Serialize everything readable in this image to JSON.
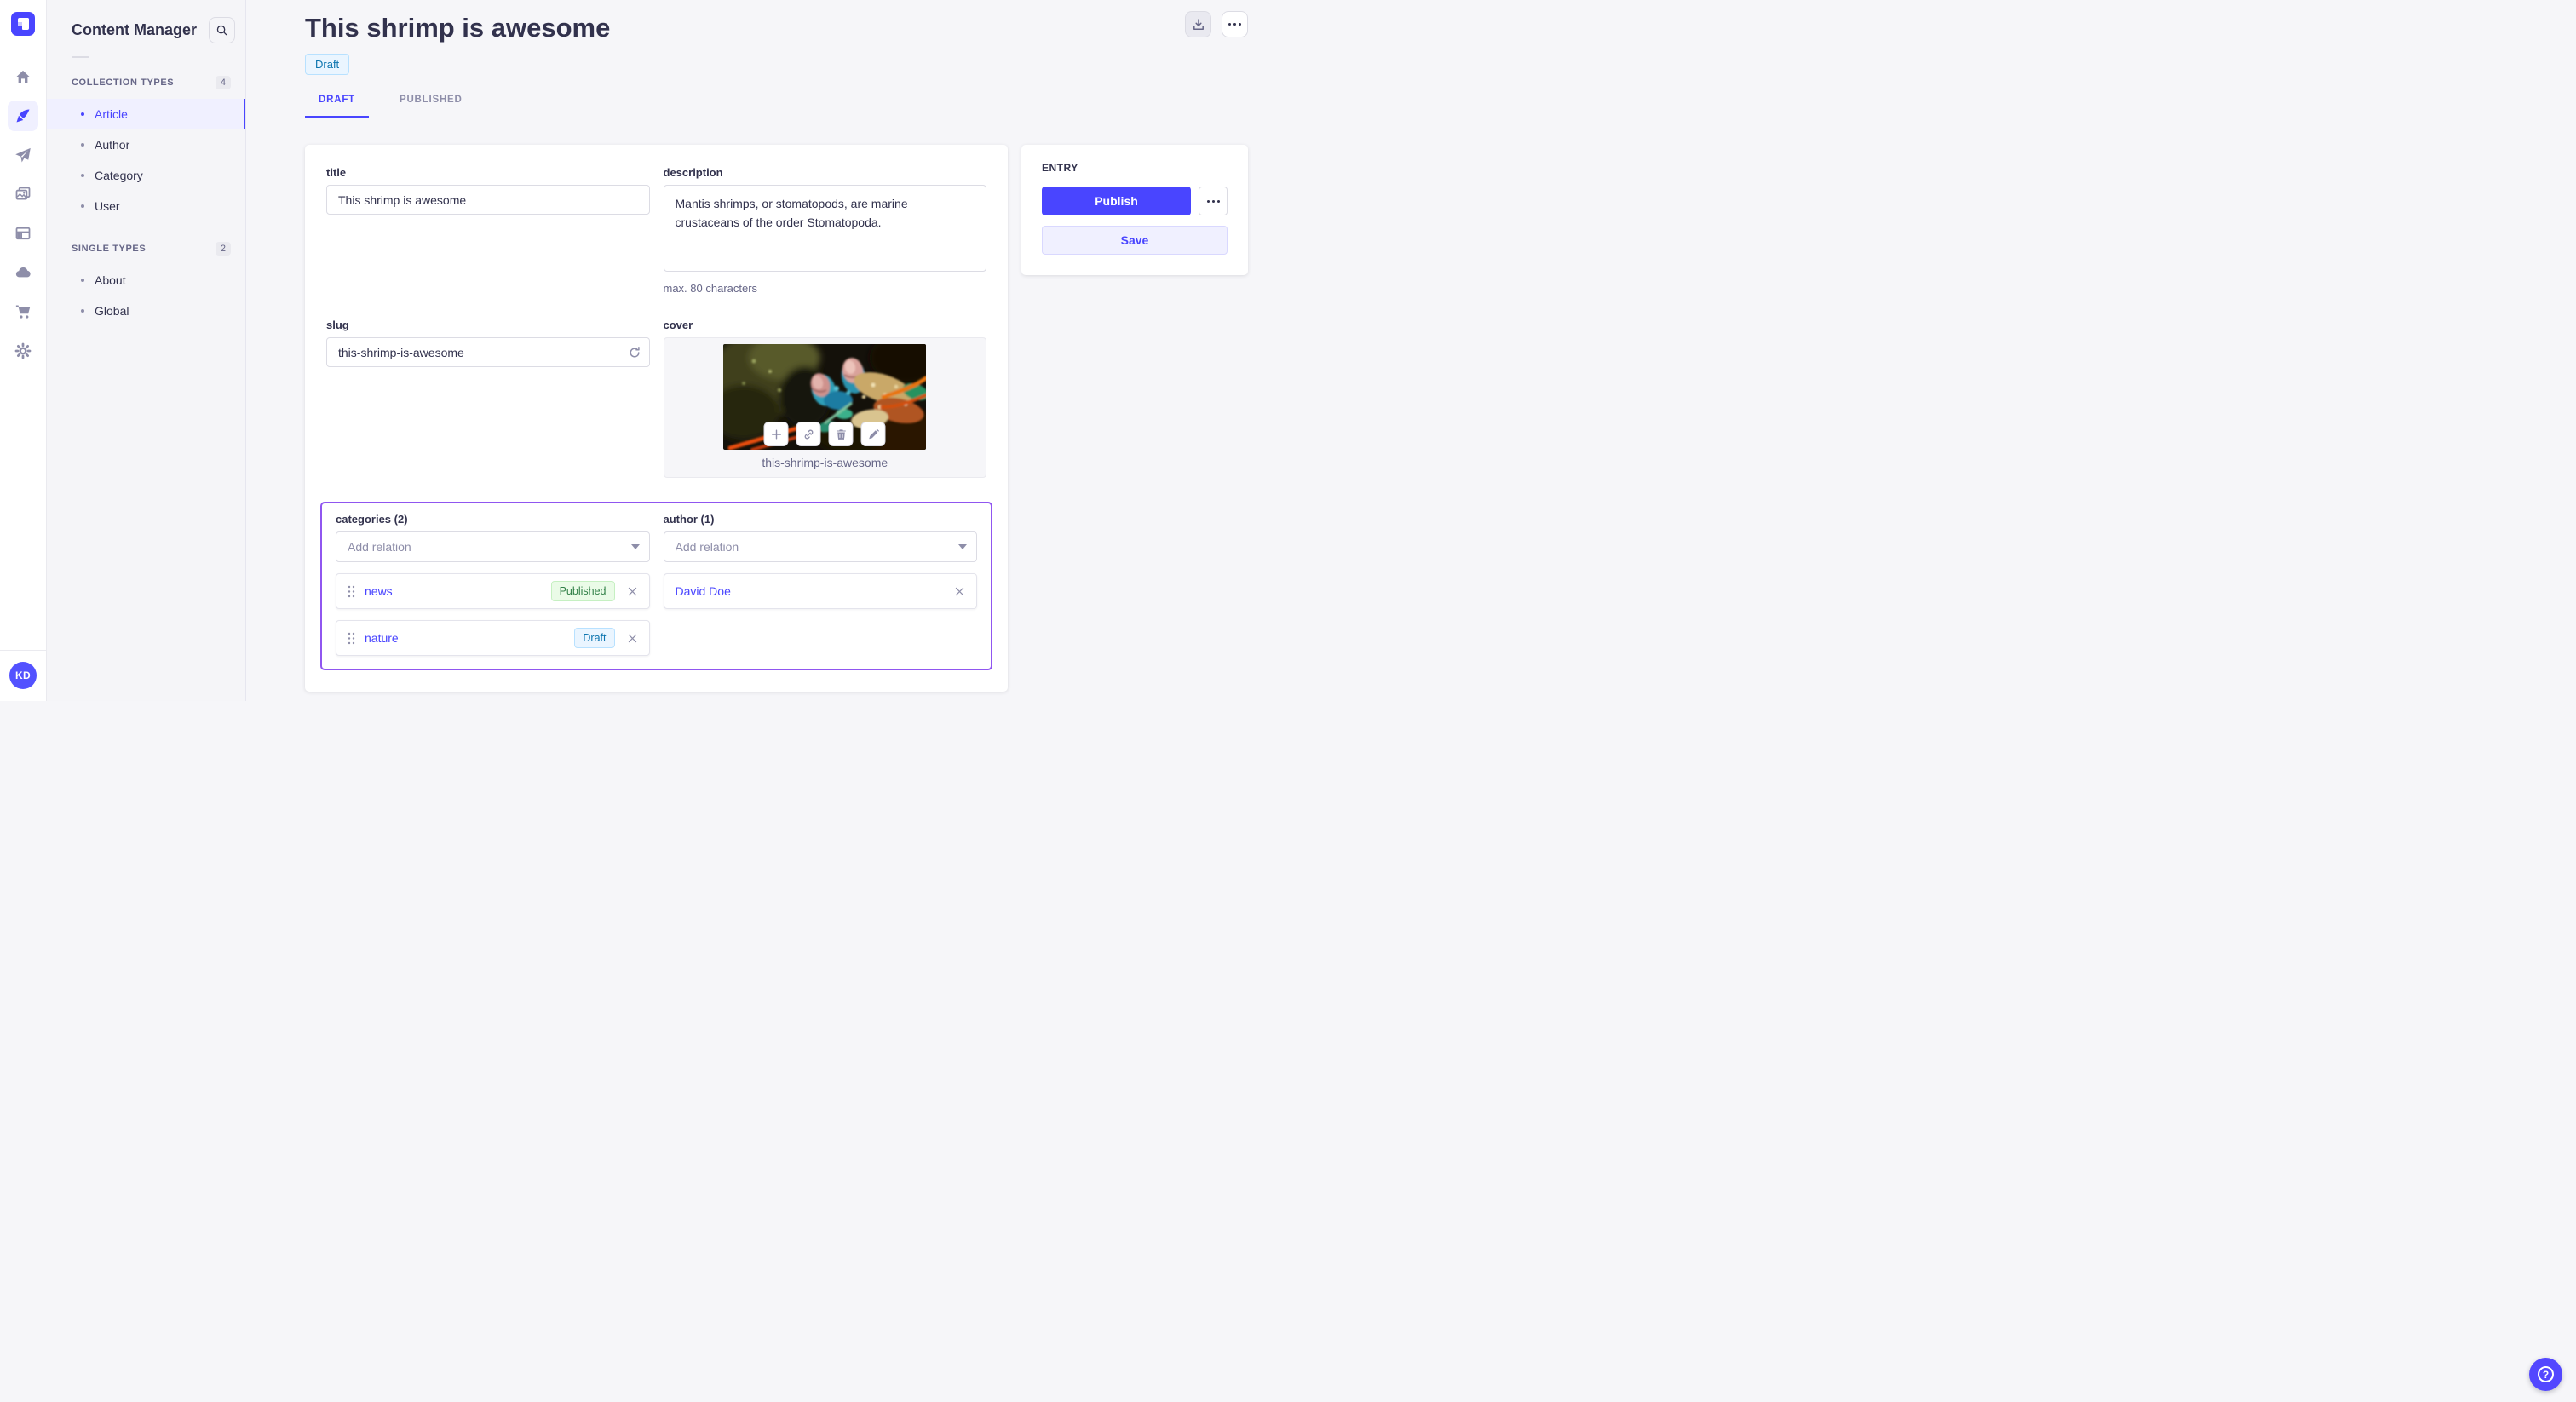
{
  "colors": {
    "primary": "#4945ff",
    "primary_light_bg": "#f0f0ff",
    "relations_highlight_border": "#9056f0",
    "draft_badge": {
      "bg": "#eaf5ff",
      "border": "#b8e1ff",
      "text": "#0c75af"
    },
    "published_badge": {
      "bg": "#eafbe7",
      "border": "#c6f0c2",
      "text": "#328048"
    }
  },
  "iconbar": {
    "logo_icon": "strapi-logo",
    "icons": [
      "home",
      "content-manager",
      "send",
      "media-library",
      "layout",
      "cloud",
      "cart",
      "settings"
    ],
    "active_icon": "content-manager",
    "avatar_initials": "KD"
  },
  "subnav": {
    "title": "Content Manager",
    "search_icon": "search",
    "sections": [
      {
        "label": "COLLECTION TYPES",
        "count": "4",
        "items": [
          {
            "label": "Article",
            "active": true
          },
          {
            "label": "Author",
            "active": false
          },
          {
            "label": "Category",
            "active": false
          },
          {
            "label": "User",
            "active": false
          }
        ]
      },
      {
        "label": "SINGLE TYPES",
        "count": "2",
        "items": [
          {
            "label": "About",
            "active": false
          },
          {
            "label": "Global",
            "active": false
          }
        ]
      }
    ]
  },
  "header": {
    "title": "This shrimp is awesome",
    "status_badge": "Draft",
    "tabs": [
      {
        "label": "DRAFT",
        "active": true
      },
      {
        "label": "PUBLISHED",
        "active": false
      }
    ]
  },
  "form": {
    "title": {
      "label": "title",
      "value": "This shrimp is awesome"
    },
    "description": {
      "label": "description",
      "value": "Mantis shrimps, or stomatopods, are marine crustaceans of the order Stomatopoda.",
      "hint": "max. 80 characters"
    },
    "slug": {
      "label": "slug",
      "value": "this-shrimp-is-awesome"
    },
    "cover": {
      "label": "cover",
      "caption": "this-shrimp-is-awesome"
    },
    "categories": {
      "label": "categories (2)",
      "placeholder": "Add relation",
      "items": [
        {
          "name": "news",
          "status": "Published"
        },
        {
          "name": "nature",
          "status": "Draft"
        }
      ]
    },
    "author": {
      "label": "author (1)",
      "placeholder": "Add relation",
      "items": [
        {
          "name": "David Doe"
        }
      ]
    }
  },
  "entry_panel": {
    "title": "ENTRY",
    "publish": "Publish",
    "save": "Save"
  },
  "fab": {
    "glyph": "?"
  }
}
